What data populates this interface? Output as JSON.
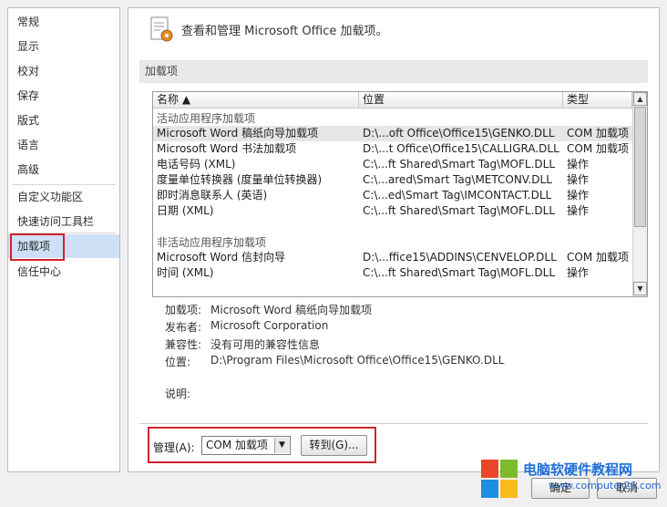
{
  "nav": {
    "items": [
      "常规",
      "显示",
      "校对",
      "保存",
      "版式",
      "语言",
      "高级",
      "自定义功能区",
      "快速访问工具栏",
      "加载项",
      "信任中心"
    ],
    "selected": "加载项"
  },
  "header": {
    "title": "查看和管理 Microsoft Office 加载项。"
  },
  "section": {
    "title": "加载项"
  },
  "list": {
    "columns": [
      "名称 ▲",
      "位置",
      "类型"
    ],
    "groups": [
      {
        "title": "活动应用程序加载项",
        "rows": [
          [
            "Microsoft Word 稿纸向导加载项",
            "D:\\...oft Office\\Office15\\GENKO.DLL",
            "COM 加载项"
          ],
          [
            "Microsoft Word 书法加载项",
            "D:\\...t Office\\Office15\\CALLIGRA.DLL",
            "COM 加载项"
          ],
          [
            "电话号码 (XML)",
            "C:\\...ft Shared\\Smart Tag\\MOFL.DLL",
            "操作"
          ],
          [
            "度量单位转换器 (度量单位转换器)",
            "C:\\...ared\\Smart Tag\\METCONV.DLL",
            "操作"
          ],
          [
            "即时消息联系人 (英语)",
            "C:\\...ed\\Smart Tag\\IMCONTACT.DLL",
            "操作"
          ],
          [
            "日期 (XML)",
            "C:\\...ft Shared\\Smart Tag\\MOFL.DLL",
            "操作"
          ]
        ]
      },
      {
        "title": "非活动应用程序加载项",
        "rows": [
          [
            "Microsoft Word 信封向导",
            "D:\\...ffice15\\ADDINS\\CENVELOP.DLL",
            "COM 加载项"
          ],
          [
            "时间 (XML)",
            "C:\\...ft Shared\\Smart Tag\\MOFL.DLL",
            "操作"
          ]
        ]
      }
    ]
  },
  "details": {
    "addin_label": "加载项:",
    "addin_value": "Microsoft Word 稿纸向导加载项",
    "publisher_label": "发布者:",
    "publisher_value": "Microsoft Corporation",
    "compat_label": "兼容性:",
    "compat_value": "没有可用的兼容性信息",
    "location_label": "位置:",
    "location_value": "D:\\Program Files\\Microsoft Office\\Office15\\GENKO.DLL",
    "desc_label": "说明:"
  },
  "manage": {
    "label": "管理(A):",
    "selected": "COM 加载项",
    "go_label": "转到(G)..."
  },
  "footer": {
    "ok_label": "确定",
    "cancel_label": "取消"
  },
  "watermark": {
    "text": "电脑软硬件教程网",
    "url": "www.computer26.com"
  }
}
